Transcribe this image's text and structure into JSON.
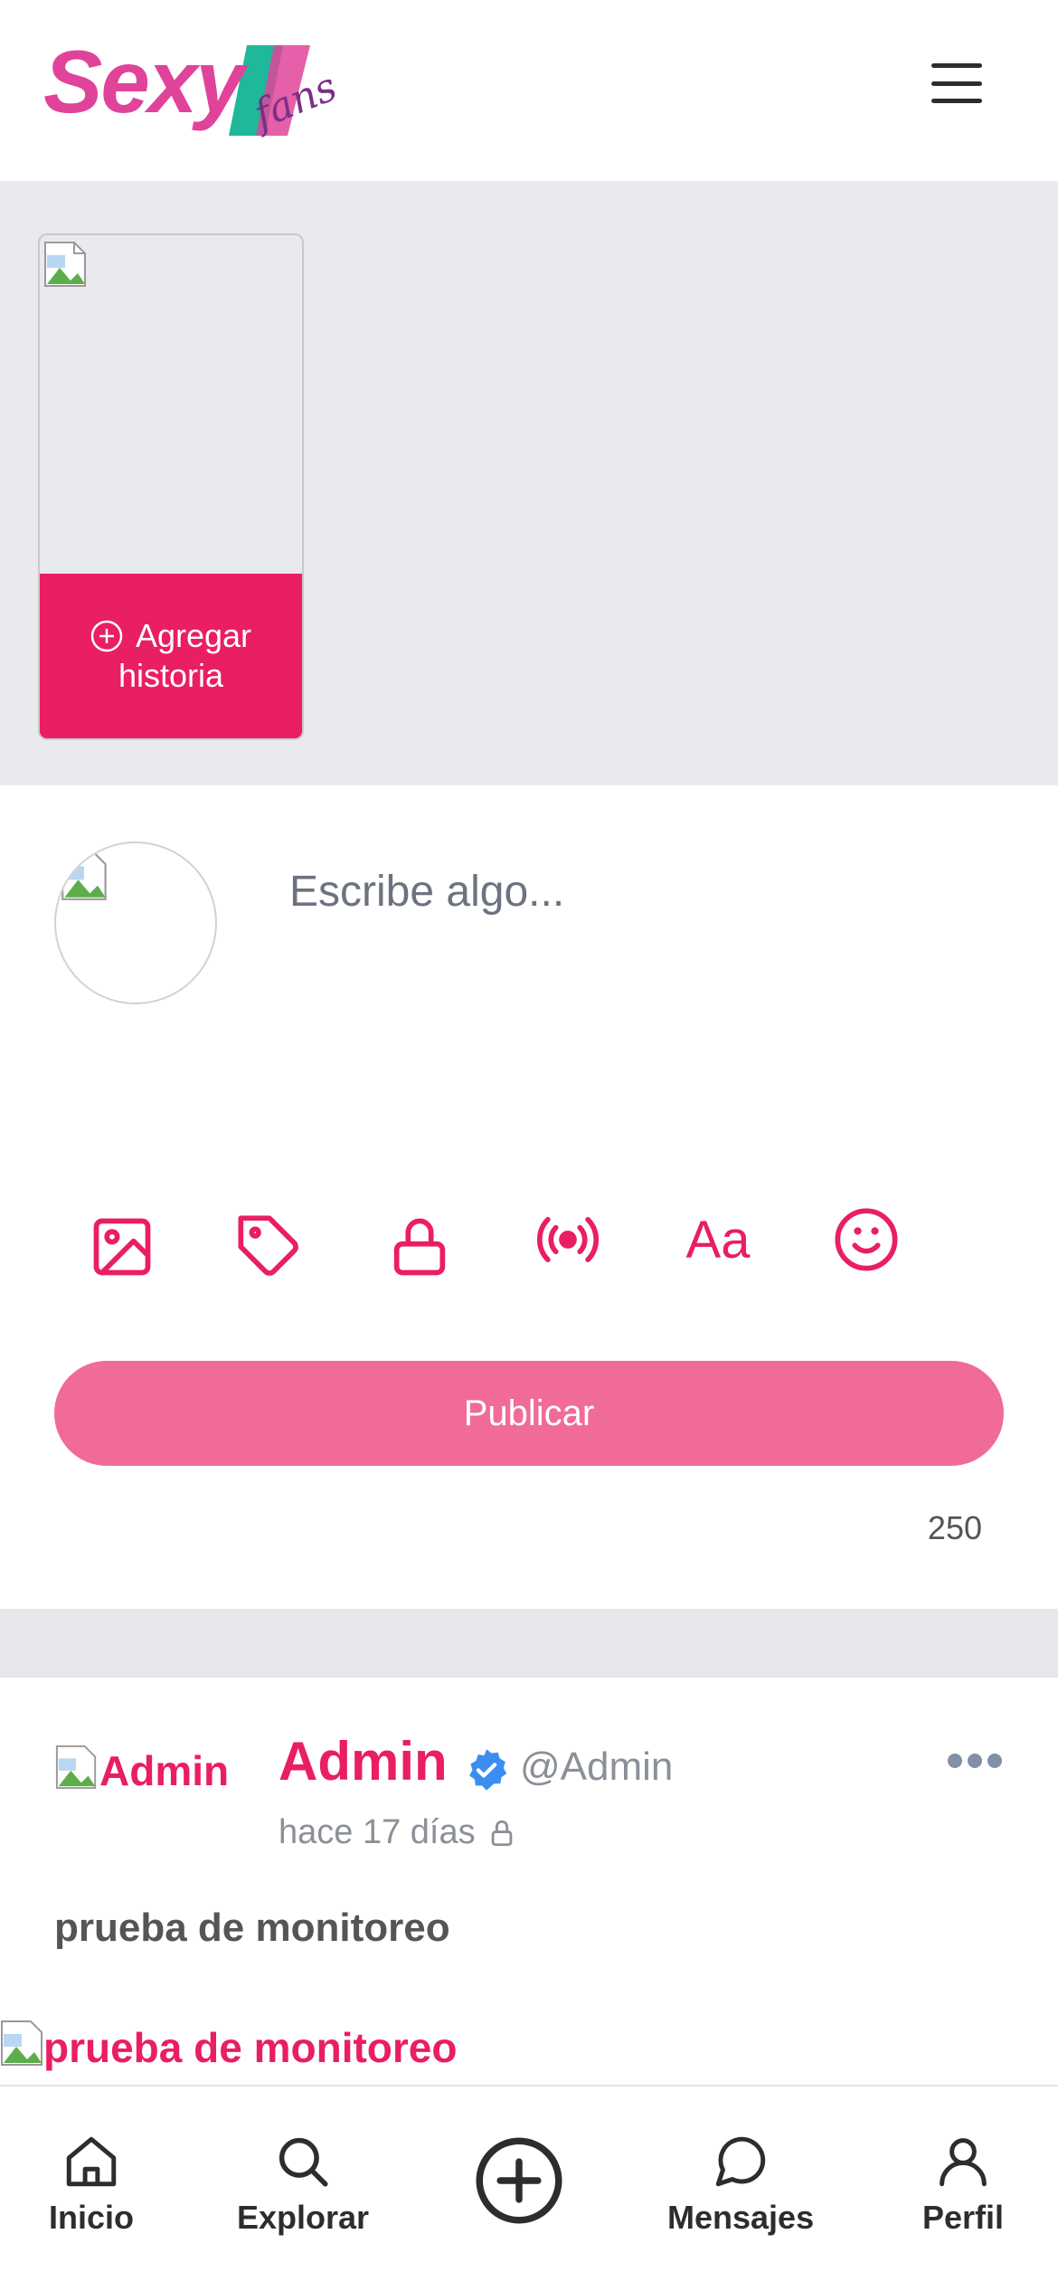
{
  "header": {
    "logo_text": "Sexy",
    "logo_sub": "fans",
    "menu_icon": "hamburger-menu-icon"
  },
  "stories": {
    "add_story_label_line1": "Agregar",
    "add_story_label_line2": "historia"
  },
  "composer": {
    "placeholder": "Escribe algo...",
    "tools": [
      "image-icon",
      "tag-icon",
      "lock-icon",
      "live-broadcast-icon",
      "text-format-icon",
      "emoji-icon"
    ],
    "text_tool_label": "Aa",
    "publish_label": "Publicar",
    "char_counter": "250"
  },
  "post": {
    "avatar_alt": "Admin",
    "author_name": "Admin",
    "author_handle": "@Admin",
    "time": "hace 17 días",
    "text": "prueba de monitoreo",
    "image_alt": "prueba de monitoreo"
  },
  "nav": {
    "home": "Inicio",
    "explore": "Explorar",
    "messages": "Mensajes",
    "profile": "Perfil"
  },
  "colors": {
    "accent": "#e91e63",
    "publish_button": "#f06b98",
    "logo_pink": "#e0439a",
    "logo_green": "#1fb89a",
    "logo_purple": "#7a2f86",
    "verified_blue": "#3b8ef0"
  }
}
